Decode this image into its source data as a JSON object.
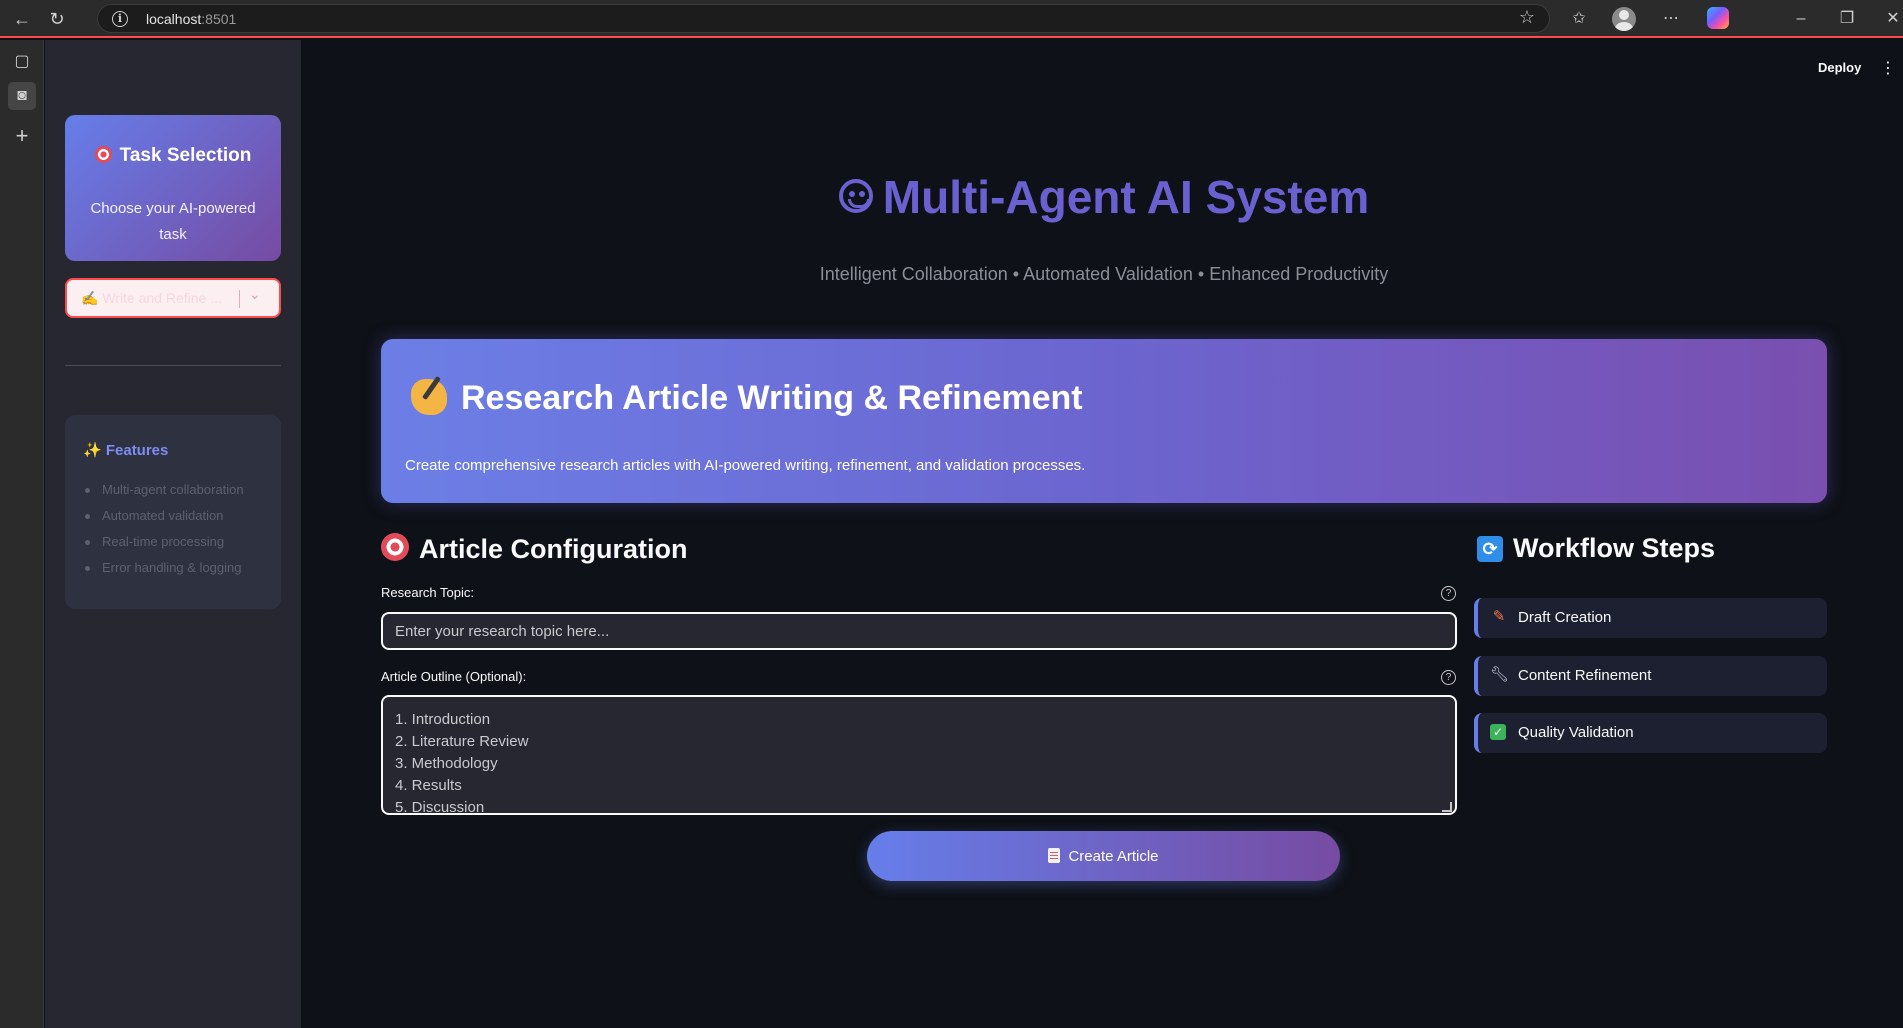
{
  "browser": {
    "url_host": "localhost",
    "url_port": ":8501",
    "back_label": "←",
    "reload_label": "↻"
  },
  "header": {
    "deploy_label": "Deploy",
    "menu_label": "⋮"
  },
  "sidebar": {
    "task_title": "Task Selection",
    "task_subtitle": "Choose your AI-powered task",
    "select_value": "✍️ Write and Refine ...",
    "features_title": "✨ Features",
    "features": [
      "Multi-agent collaboration",
      "Automated validation",
      "Real-time processing",
      "Error handling & logging"
    ]
  },
  "main": {
    "title": "Multi-Agent AI System",
    "subtitle": "Intelligent Collaboration • Automated Validation • Enhanced Productivity",
    "hero_title": "Research Article Writing & Refinement",
    "hero_description": "Create comprehensive research articles with AI-powered writing, refinement, and validation processes.",
    "config_title": "Article Configuration",
    "topic_label": "Research Topic:",
    "topic_placeholder": "Enter your research topic here...",
    "topic_value": "",
    "outline_label": "Article Outline (Optional):",
    "outline_value": "1. Introduction\n2. Literature Review\n3. Methodology\n4. Results\n5. Discussion",
    "create_button": "Create Article",
    "workflow_title": "Workflow Steps",
    "workflow_steps": [
      {
        "icon": "pencil-icon",
        "label": "Draft Creation"
      },
      {
        "icon": "wrench-icon",
        "label": "Content Refinement"
      },
      {
        "icon": "checkmark-icon",
        "label": "Quality Validation"
      }
    ]
  },
  "colors": {
    "accent": "#667eea",
    "accent_end": "#764ba2",
    "title": "#6a60d0",
    "danger": "#ff4b4b",
    "background": "#0e1117",
    "sidebar": "#262730"
  }
}
